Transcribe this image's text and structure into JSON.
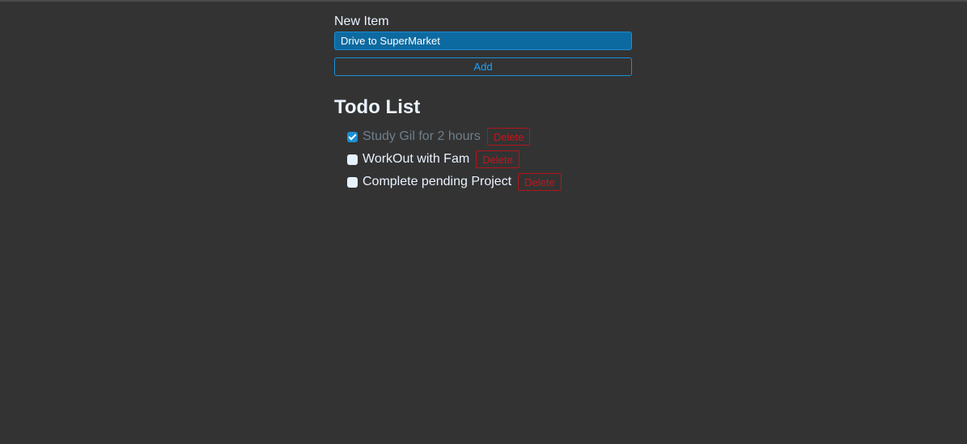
{
  "form": {
    "label": "New Item",
    "input_value": "Drive to SuperMarket",
    "add_label": "Add"
  },
  "list": {
    "title": "Todo List",
    "items": [
      {
        "text": "Study Gil for 2 hours",
        "completed": true,
        "delete_label": "Delete"
      },
      {
        "text": "WorkOut with Fam",
        "completed": false,
        "delete_label": "Delete"
      },
      {
        "text": "Complete pending Project",
        "completed": false,
        "delete_label": "Delete"
      }
    ]
  },
  "colors": {
    "background": "#333333",
    "accent": "#1a8fd6",
    "danger": "#c4161c",
    "input_fill": "#0d6aa0",
    "completed_text": "#6f7f8c"
  }
}
